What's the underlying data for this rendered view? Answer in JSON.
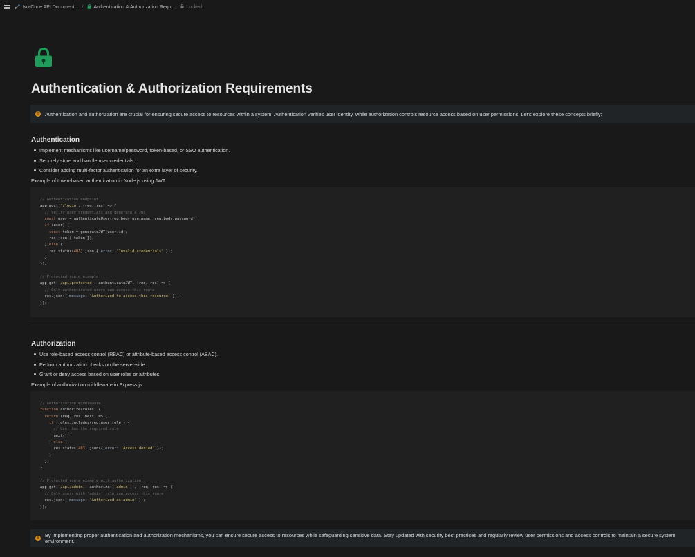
{
  "topbar": {
    "crumb1": "No-Code API Document...",
    "crumb2": "Authentication & Authorization Requ...",
    "locked": "Locked"
  },
  "page": {
    "title": "Authentication & Authorization Requirements",
    "intro_callout": "Authentication and authorization are crucial for ensuring secure access to resources within a system. Authentication verifies user identity, while authorization controls resource access based on user permissions. Let's explore these concepts briefly:",
    "outro_callout": "By implementing proper authentication and authorization mechanisms, you can ensure secure access to resources while safeguarding sensitive data. Stay updated with security best practices and regularly review user permissions and access controls to maintain a secure system environment."
  },
  "authentication": {
    "heading": "Authentication",
    "bullets": [
      "Implement mechanisms like username/password, token-based, or SSO authentication.",
      "Securely store and handle user credentials.",
      "Consider adding multi-factor authentication for an extra layer of security."
    ],
    "example_label": "Example of token-based authentication in Node.js using JWT:",
    "code_lines": [
      "// Authentication endpoint",
      "app.post('/login', (req, res) => {",
      "  // Verify user credentials and generate a JWT",
      "  const user = authenticateUser(req.body.username, req.body.password);",
      "  if (user) {",
      "    const token = generateJWT(user.id);",
      "    res.json({ token });",
      "  } else {",
      "    res.status(401).json({ error: 'Invalid credentials' });",
      "  }",
      "});",
      "",
      "// Protected route example",
      "app.get('/api/protected', authenticateJWT, (req, res) => {",
      "  // Only authenticated users can access this route",
      "  res.json({ message: 'Authorized to access this resource' });",
      "});"
    ]
  },
  "authorization": {
    "heading": "Authorization",
    "bullets": [
      "Use role-based access control (RBAC) or attribute-based access control (ABAC).",
      "Perform authorization checks on the server-side.",
      "Grant or deny access based on user roles or attributes."
    ],
    "example_label": "Example of authorization middleware in Express.js:",
    "code_lines": [
      "// Authorization middleware",
      "function authorize(roles) {",
      "  return (req, res, next) => {",
      "    if (roles.includes(req.user.role)) {",
      "      // User has the required role",
      "      next();",
      "    } else {",
      "      res.status(403).json({ error: 'Access denied' });",
      "    }",
      "  };",
      "}",
      "",
      "// Protected route example with authorization",
      "app.get('/api/admin', authorize(['admin']), (req, res) => {",
      "  // Only users with 'admin' role can access this route",
      "  res.json({ message: 'Authorized as admin' });",
      "});"
    ]
  },
  "colors": {
    "background": "#191919",
    "callout_bg": "#202426",
    "callout_icon": "#d08a1e",
    "page_icon": "#1f9b5a",
    "code_bg": "#202020"
  },
  "icons": {
    "menu": "hamburger-icon",
    "workspace": "api-icon",
    "page": "lock-icon",
    "callout": "info-icon"
  }
}
